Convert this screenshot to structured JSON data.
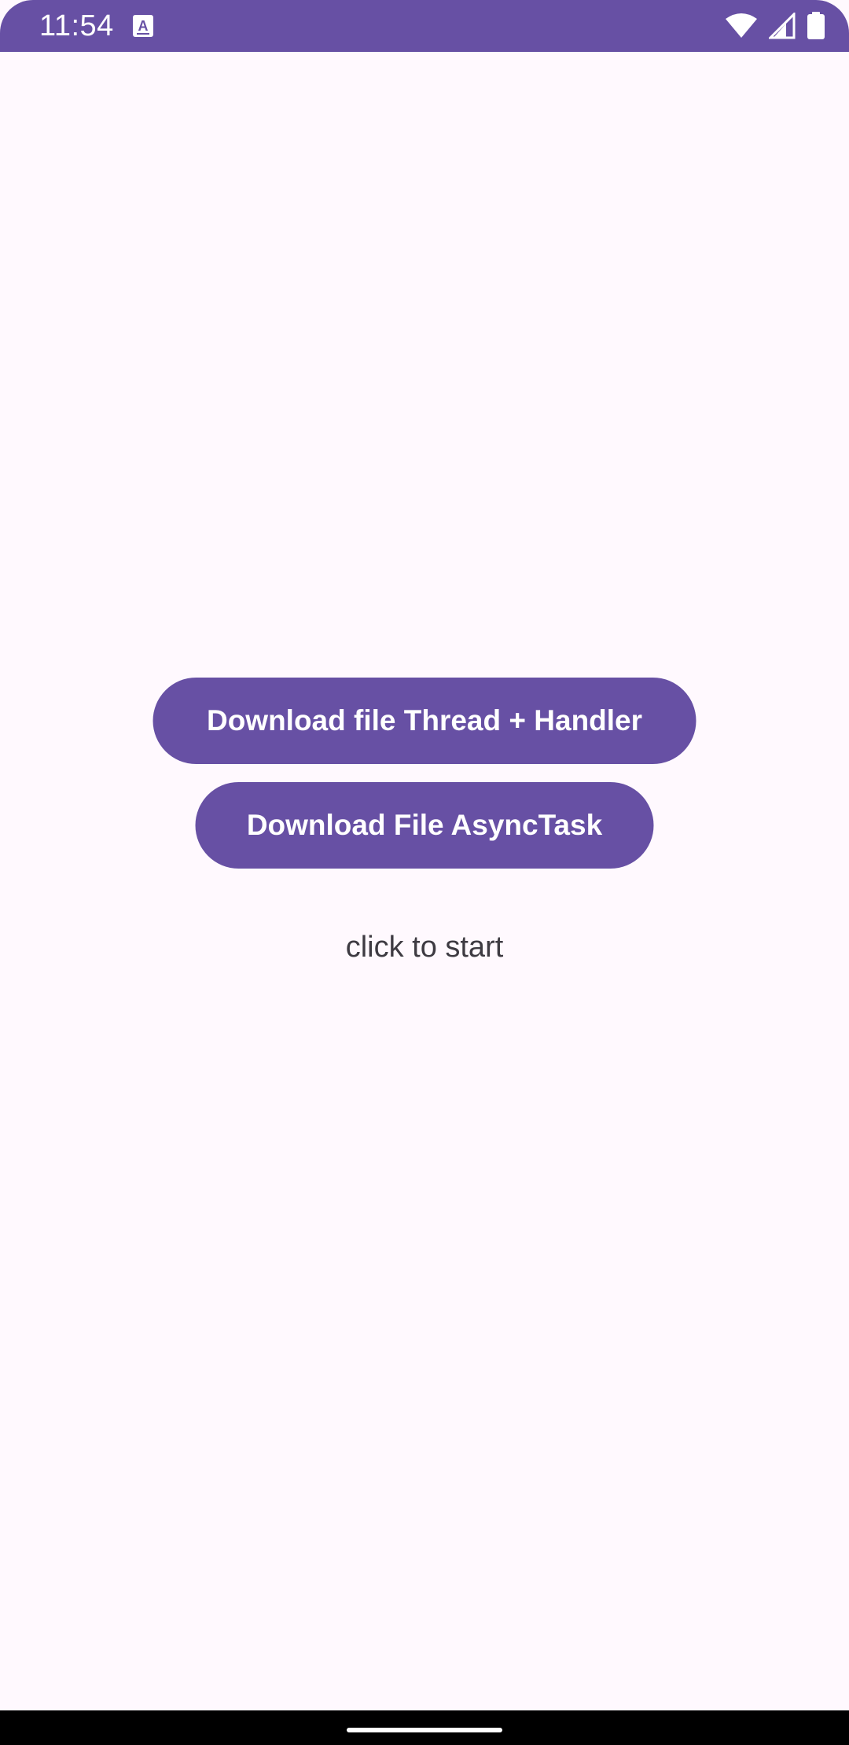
{
  "status_bar": {
    "time": "11:54",
    "notification_icon": "a-box-icon",
    "icons": [
      "wifi-icon",
      "cell-signal-icon",
      "battery-icon"
    ],
    "color": "#6750A4"
  },
  "main": {
    "thread_button_label": "Download file Thread + Handler",
    "async_button_label": "Download File AsyncTask",
    "status_text": "click to start"
  },
  "colors": {
    "accent": "#6750A4",
    "background": "#FFF9FE",
    "status_text": "#3E3B42"
  }
}
